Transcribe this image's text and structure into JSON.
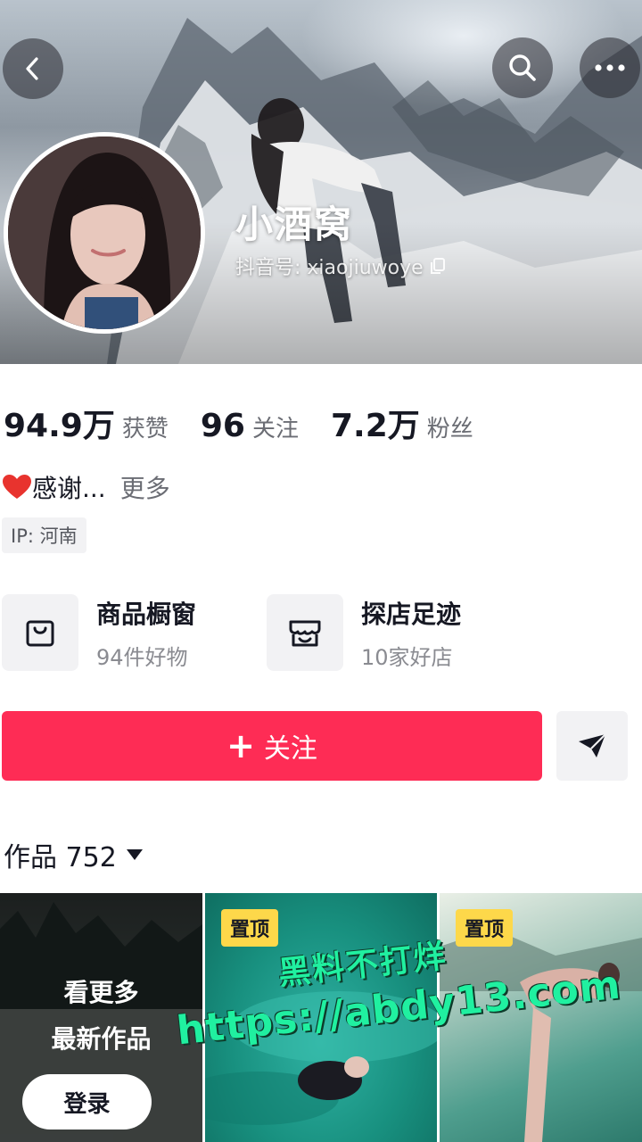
{
  "profile": {
    "nickname": "小酒窝",
    "douyin_id": "抖音号: xiaojiuwoye",
    "bio": "感谢...",
    "bio_more": "更多",
    "ip_location": "IP: 河南"
  },
  "stats": [
    {
      "value": "94.9万",
      "label": "获赞"
    },
    {
      "value": "96",
      "label": "关注"
    },
    {
      "value": "7.2万",
      "label": "粉丝"
    }
  ],
  "entries": [
    {
      "title": "商品橱窗",
      "subtitle": "94件好物",
      "icon": "shopping-bag-icon"
    },
    {
      "title": "探店足迹",
      "subtitle": "10家好店",
      "icon": "store-icon"
    }
  ],
  "actions": {
    "follow_label": "关注",
    "follow_plus": "+"
  },
  "works": {
    "title": "作品 752",
    "see_more_line1": "看更多",
    "see_more_line2": "最新作品",
    "login_label": "登录",
    "pinned_label": "置顶"
  },
  "watermark": {
    "line1": "黑料不打烊",
    "line2": "https://abdy13.com"
  },
  "colors": {
    "accent": "#fe2c55",
    "pin": "#fdd84a",
    "watermark": "#20f0a0"
  }
}
